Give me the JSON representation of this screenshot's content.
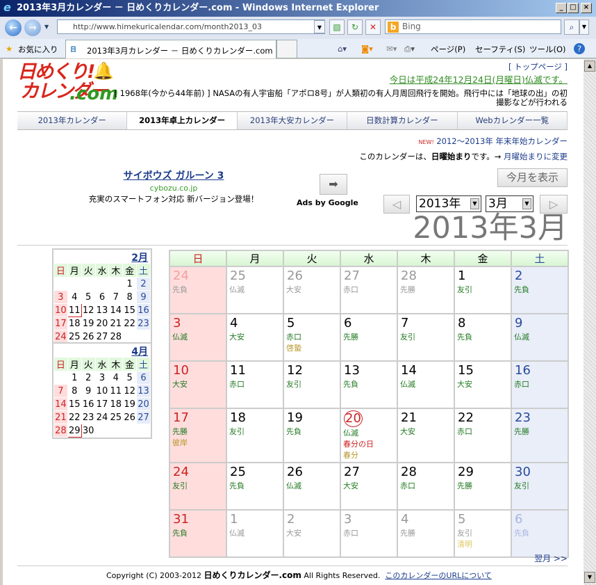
{
  "window": {
    "title": "2013年3月カレンダー － 日めくりカレンダー.com - Windows Internet Explorer"
  },
  "browser": {
    "url": "http://www.himekuricalendar.com/month2013_03",
    "search_placeholder": "Bing",
    "favorites": "お気に入り",
    "tab_title": "2013年3月カレンダー － 日めくりカレンダー.com",
    "menu": [
      "ページ(P)",
      "セーフティ(S)",
      "ツール(O)"
    ]
  },
  "header": {
    "logo_line1": "日めくり!",
    "logo_line2": "カレンダー",
    "logo_line3": ".com",
    "top_page": "[ トップページ ]",
    "today": "今日は平成24年12月24日(月曜日)仏滅です。",
    "history_line1": "[ 1968年(今から44年前) ] NASAの有人宇宙船「アポロ8号」が人類初の有人月周回飛行を開始。飛行中には「地球の出」の初",
    "history_line2": "撮影などが行われる"
  },
  "nav": [
    "2013年カレンダー",
    "2013年卓上カレンダー",
    "2013年大安カレンダー",
    "日数計算カレンダー",
    "Webカレンダー一覧"
  ],
  "notice": {
    "new_badge": "NEW!",
    "new_link": "2012～2013年 年末年始カレンダー",
    "start_prefix": "このカレンダーは、",
    "start_bold": "日曜始まり",
    "start_suffix": "です。→",
    "start_link": "月曜始まりに変更"
  },
  "ad": {
    "title": "サイボウズ ガルーン 3",
    "domain": "cybozu.co.jp",
    "desc": "充実のスマートフォン対応 新バージョン登場！",
    "ads_by": "Ads by Google"
  },
  "controls": {
    "today_button": "今月を表示",
    "year": "2013年",
    "month": "3月",
    "big_title": "2013年3月",
    "next_month": "翌月 >>"
  },
  "weekdays": [
    "日",
    "月",
    "火",
    "水",
    "木",
    "金",
    "土"
  ],
  "mini": [
    {
      "title": "2月",
      "weeks": [
        [
          "",
          "",
          "",
          "",
          "",
          "1",
          "2"
        ],
        [
          "3",
          "4",
          "5",
          "6",
          "7",
          "8",
          "9"
        ],
        [
          "10",
          "11",
          "12",
          "13",
          "14",
          "15",
          "16"
        ],
        [
          "17",
          "18",
          "19",
          "20",
          "21",
          "22",
          "23"
        ],
        [
          "24",
          "25",
          "26",
          "27",
          "28",
          "",
          ""
        ]
      ],
      "ring": "11"
    },
    {
      "title": "4月",
      "weeks": [
        [
          "",
          "1",
          "2",
          "3",
          "4",
          "5",
          "6"
        ],
        [
          "7",
          "8",
          "9",
          "10",
          "11",
          "12",
          "13"
        ],
        [
          "14",
          "15",
          "16",
          "17",
          "18",
          "19",
          "20"
        ],
        [
          "21",
          "22",
          "23",
          "24",
          "25",
          "26",
          "27"
        ],
        [
          "28",
          "29",
          "30",
          "",
          "",
          "",
          ""
        ]
      ],
      "ring": "29"
    }
  ],
  "calendar": [
    [
      {
        "d": "24",
        "r": "先負",
        "dim": 1
      },
      {
        "d": "25",
        "r": "仏滅",
        "dim": 1
      },
      {
        "d": "26",
        "r": "大安",
        "dim": 1
      },
      {
        "d": "27",
        "r": "赤口",
        "dim": 1
      },
      {
        "d": "28",
        "r": "先勝",
        "dim": 1
      },
      {
        "d": "1",
        "r": "友引"
      },
      {
        "d": "2",
        "r": "先負"
      }
    ],
    [
      {
        "d": "3",
        "r": "仏滅"
      },
      {
        "d": "4",
        "r": "大安"
      },
      {
        "d": "5",
        "r": "赤口",
        "e": "啓蟄"
      },
      {
        "d": "6",
        "r": "先勝"
      },
      {
        "d": "7",
        "r": "友引"
      },
      {
        "d": "8",
        "r": "先負"
      },
      {
        "d": "9",
        "r": "仏滅"
      }
    ],
    [
      {
        "d": "10",
        "r": "大安"
      },
      {
        "d": "11",
        "r": "赤口"
      },
      {
        "d": "12",
        "r": "友引"
      },
      {
        "d": "13",
        "r": "先負"
      },
      {
        "d": "14",
        "r": "仏滅"
      },
      {
        "d": "15",
        "r": "大安"
      },
      {
        "d": "16",
        "r": "赤口"
      }
    ],
    [
      {
        "d": "17",
        "r": "先勝",
        "e": "彼岸"
      },
      {
        "d": "18",
        "r": "友引"
      },
      {
        "d": "19",
        "r": "先負"
      },
      {
        "d": "20",
        "r": "仏滅",
        "h": "春分の日",
        "e": "春分",
        "ring": 1
      },
      {
        "d": "21",
        "r": "大安"
      },
      {
        "d": "22",
        "r": "赤口"
      },
      {
        "d": "23",
        "r": "先勝"
      }
    ],
    [
      {
        "d": "24",
        "r": "友引"
      },
      {
        "d": "25",
        "r": "先負"
      },
      {
        "d": "26",
        "r": "仏滅"
      },
      {
        "d": "27",
        "r": "大安"
      },
      {
        "d": "28",
        "r": "赤口"
      },
      {
        "d": "29",
        "r": "先勝"
      },
      {
        "d": "30",
        "r": "友引"
      }
    ],
    [
      {
        "d": "31",
        "r": "先負"
      },
      {
        "d": "1",
        "r": "仏滅",
        "dim": 1
      },
      {
        "d": "2",
        "r": "大安",
        "dim": 1
      },
      {
        "d": "3",
        "r": "赤口",
        "dim": 1
      },
      {
        "d": "4",
        "r": "先勝",
        "dim": 1
      },
      {
        "d": "5",
        "r": "友引",
        "e": "清明",
        "dim": 1
      },
      {
        "d": "6",
        "r": "先負",
        "dim": 1
      }
    ]
  ],
  "footer": {
    "copyright": "Copyright (C) 2003-2012",
    "brand": "日めくりカレンダー.com",
    "rights": "All Rights Reserved.",
    "url_link": "このカレンダーのURLについて"
  }
}
